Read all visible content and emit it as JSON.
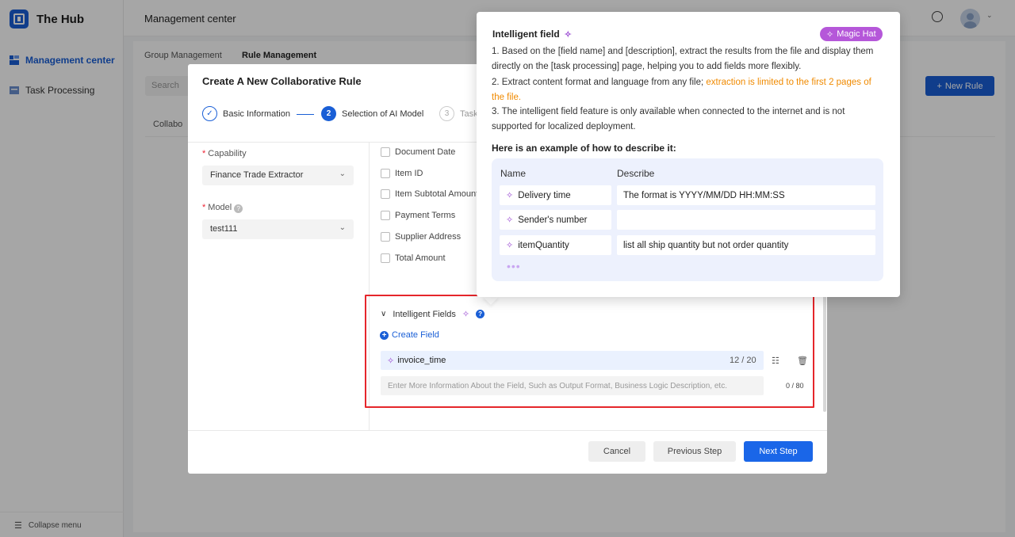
{
  "app": {
    "name": "The Hub"
  },
  "sidebar": {
    "items": [
      {
        "label": "Management center"
      },
      {
        "label": "Task Processing"
      }
    ],
    "collapse_label": "Collapse menu"
  },
  "header": {
    "title": "Management center"
  },
  "background": {
    "tabs": [
      {
        "label": "Group Management"
      },
      {
        "label": "Rule Management"
      }
    ],
    "search_placeholder": "Search",
    "new_rule_label": "New Rule",
    "column_label": "Collabo"
  },
  "modal": {
    "title": "Create A New Collaborative Rule",
    "steps": [
      {
        "number": "1",
        "label": "Basic Information"
      },
      {
        "number": "2",
        "label": "Selection of AI Model"
      },
      {
        "number": "3",
        "label": "Task"
      }
    ],
    "capability_label": "Capability",
    "capability_value": "Finance Trade Extractor",
    "model_label": "Model",
    "model_value": "test111",
    "checkbox_fields": [
      "Document Date",
      "Item ID",
      "Item Subtotal Amount",
      "Payment Terms",
      "Supplier Address",
      "Total Amount"
    ],
    "intelligent_fields_label": "Intelligent Fields",
    "create_field_label": "Create Field",
    "field_name_value": "invoice_time",
    "field_name_count": "12 / 20",
    "field_desc_placeholder": "Enter More Information About the Field, Such as Output Format, Business Logic Description, etc.",
    "field_desc_count": "0 / 80",
    "buttons": {
      "cancel": "Cancel",
      "previous": "Previous Step",
      "next": "Next Step"
    }
  },
  "popover": {
    "title": "Intelligent field",
    "badge": "Magic Hat",
    "p1": "1. Based on the [field name] and [description], extract the results from the file and display them directly on the [task processing] page, helping you to add fields more flexibly.",
    "p2_start": "2. Extract content format and language from any file; ",
    "p2_highlight": "extraction is limited to the first 2 pages of the file.",
    "p3": "3. The intelligent field feature is only available when connected to the internet and is not supported for localized deployment.",
    "example_title": "Here is an example of how to describe it:",
    "col_name": "Name",
    "col_describe": "Describe",
    "rows": [
      {
        "name": "Delivery time",
        "describe": "The format is YYYY/MM/DD HH:MM:SS"
      },
      {
        "name": "Sender's number",
        "describe": ""
      },
      {
        "name": "itemQuantity",
        "describe": "list all ship quantity but not order quantity"
      }
    ],
    "ellipsis": "•••"
  },
  "colors": {
    "primary": "#1a5fd6",
    "accent_purple": "#b557d9",
    "highlight_orange": "#f08a00",
    "red_outline": "#e5262b"
  }
}
